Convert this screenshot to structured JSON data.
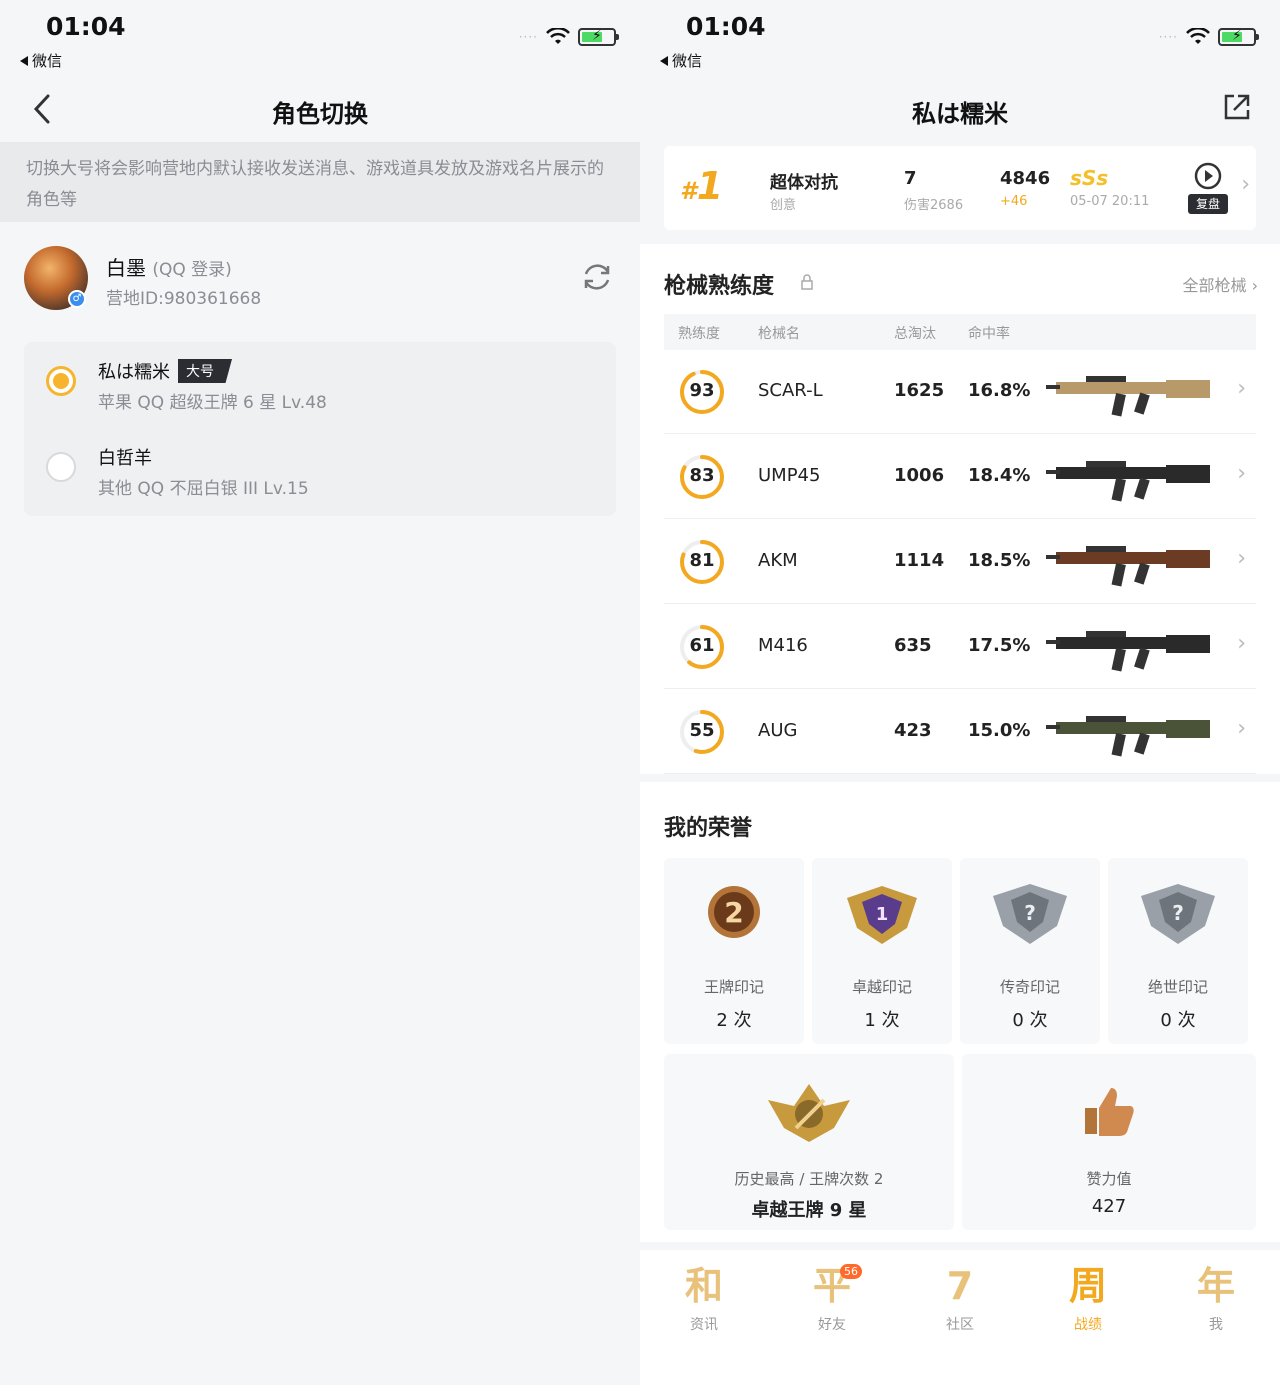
{
  "left": {
    "status": {
      "time": "01:04",
      "back_app": "微信"
    },
    "nav": {
      "title": "角色切换"
    },
    "notice": "切换大号将会影响营地内默认接收发送消息、游戏道具发放及游戏名片展示的角色等",
    "account": {
      "name": "白墨",
      "login": "(QQ 登录)",
      "camp_id": "营地ID:980361668"
    },
    "roles": [
      {
        "name": "私は糯米",
        "tag": "大号",
        "info": "苹果 QQ   超级王牌 6 星   Lv.48",
        "selected": true
      },
      {
        "name": "白哲羊",
        "info": "其他 QQ   不屈白银 III   Lv.15",
        "selected": false
      }
    ]
  },
  "right": {
    "status": {
      "time": "01:04",
      "back_app": "微信"
    },
    "nav": {
      "title": "私は糯米"
    },
    "match": {
      "rank_hash": "#",
      "rank": "1",
      "mode": "超体对抗",
      "mode_sub": "创意",
      "kills": "7",
      "damage": "伤害2686",
      "score": "4846",
      "score_delta": "+46",
      "grade": "sSs",
      "date": "05-07 20:11",
      "replay_label": "复盘"
    },
    "guns_section": {
      "title": "枪械熟练度",
      "all_link": "全部枪械",
      "headers": [
        "熟练度",
        "枪械名",
        "总淘汰",
        "命中率"
      ],
      "rows": [
        {
          "level": "93",
          "name": "SCAR-L",
          "eliminations": "1625",
          "hit_rate": "16.8%",
          "progress": 0.93
        },
        {
          "level": "83",
          "name": "UMP45",
          "eliminations": "1006",
          "hit_rate": "18.4%",
          "progress": 0.83
        },
        {
          "level": "81",
          "name": "AKM",
          "eliminations": "1114",
          "hit_rate": "18.5%",
          "progress": 0.81
        },
        {
          "level": "61",
          "name": "M416",
          "eliminations": "635",
          "hit_rate": "17.5%",
          "progress": 0.61
        },
        {
          "level": "55",
          "name": "AUG",
          "eliminations": "423",
          "hit_rate": "15.0%",
          "progress": 0.55
        }
      ]
    },
    "honors": {
      "title": "我的荣誉",
      "marks": [
        {
          "label": "王牌印记",
          "count": "2 次",
          "icon": "ace-mark-icon"
        },
        {
          "label": "卓越印记",
          "count": "1 次",
          "icon": "excellence-mark-icon"
        },
        {
          "label": "传奇印记",
          "count": "0 次",
          "icon": "legend-mark-icon"
        },
        {
          "label": "绝世印记",
          "count": "0 次",
          "icon": "peerless-mark-icon"
        }
      ],
      "highest": {
        "label": "历史最高 / 王牌次数 2",
        "value": "卓越王牌 9 星"
      },
      "likes": {
        "label": "赞力值",
        "value": "427"
      }
    },
    "tabbar": [
      {
        "glyph": "和",
        "label": "资讯"
      },
      {
        "glyph": "平",
        "label": "好友",
        "badge": "56"
      },
      {
        "glyph": "7",
        "label": "社区"
      },
      {
        "glyph": "周",
        "label": "战绩",
        "active": true
      },
      {
        "glyph": "年",
        "label": "我"
      }
    ]
  },
  "colors": {
    "accent": "#f3a91f",
    "radio_on": "#f6b52c",
    "tag_bg": "#2b2d33"
  }
}
